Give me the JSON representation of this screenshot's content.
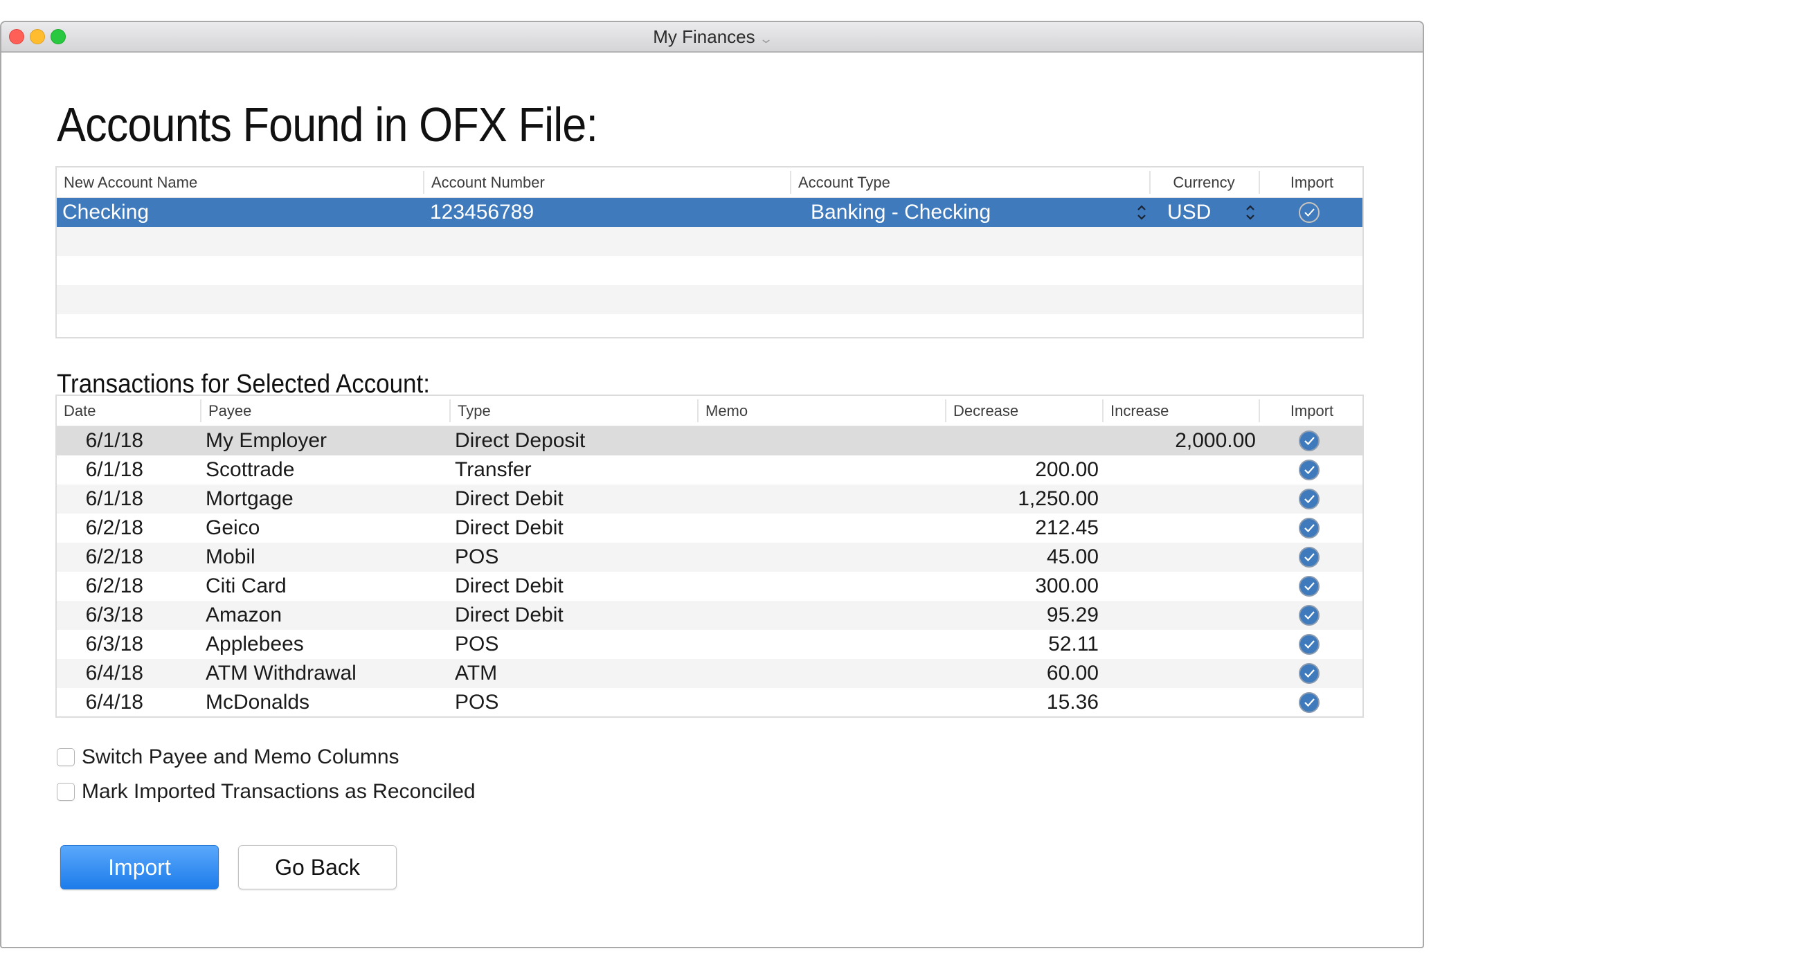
{
  "window": {
    "title": "My Finances",
    "title_menu_icon": "chevron-down-icon"
  },
  "header": {
    "title": "Accounts Found in OFX File:"
  },
  "accounts_table": {
    "columns": [
      "New Account Name",
      "Account Number",
      "Account Type",
      "Currency",
      "Import"
    ],
    "rows": [
      {
        "name": "Checking",
        "number": "123456789",
        "type": "Banking - Checking",
        "currency": "USD",
        "import": true,
        "selected": true
      }
    ]
  },
  "transactions": {
    "title": "Transactions for Selected Account:",
    "columns": [
      "Date",
      "Payee",
      "Type",
      "Memo",
      "Decrease",
      "Increase",
      "Import"
    ],
    "rows": [
      {
        "date": "6/1/18",
        "payee": "My Employer",
        "type": "Direct Deposit",
        "memo": "",
        "decrease": "",
        "increase": "2,000.00",
        "import": true
      },
      {
        "date": "6/1/18",
        "payee": "Scottrade",
        "type": "Transfer",
        "memo": "",
        "decrease": "200.00",
        "increase": "",
        "import": true
      },
      {
        "date": "6/1/18",
        "payee": "Mortgage",
        "type": "Direct Debit",
        "memo": "",
        "decrease": "1,250.00",
        "increase": "",
        "import": true
      },
      {
        "date": "6/2/18",
        "payee": "Geico",
        "type": "Direct Debit",
        "memo": "",
        "decrease": "212.45",
        "increase": "",
        "import": true
      },
      {
        "date": "6/2/18",
        "payee": "Mobil",
        "type": "POS",
        "memo": "",
        "decrease": "45.00",
        "increase": "",
        "import": true
      },
      {
        "date": "6/2/18",
        "payee": "Citi Card",
        "type": "Direct Debit",
        "memo": "",
        "decrease": "300.00",
        "increase": "",
        "import": true
      },
      {
        "date": "6/3/18",
        "payee": "Amazon",
        "type": "Direct Debit",
        "memo": "",
        "decrease": "95.29",
        "increase": "",
        "import": true
      },
      {
        "date": "6/3/18",
        "payee": "Applebees",
        "type": "POS",
        "memo": "",
        "decrease": "52.11",
        "increase": "",
        "import": true
      },
      {
        "date": "6/4/18",
        "payee": "ATM Withdrawal",
        "type": "ATM",
        "memo": "",
        "decrease": "60.00",
        "increase": "",
        "import": true
      },
      {
        "date": "6/4/18",
        "payee": "McDonalds",
        "type": "POS",
        "memo": "",
        "decrease": "15.36",
        "increase": "",
        "import": true
      }
    ]
  },
  "options": [
    {
      "label": "Switch Payee and Memo Columns",
      "checked": false
    },
    {
      "label": "Mark Imported Transactions as Reconciled",
      "checked": false
    }
  ],
  "buttons": {
    "import": "Import",
    "go_back": "Go Back"
  },
  "colors": {
    "selection": "#3f7abd",
    "primary_button": "#1d7cea"
  }
}
